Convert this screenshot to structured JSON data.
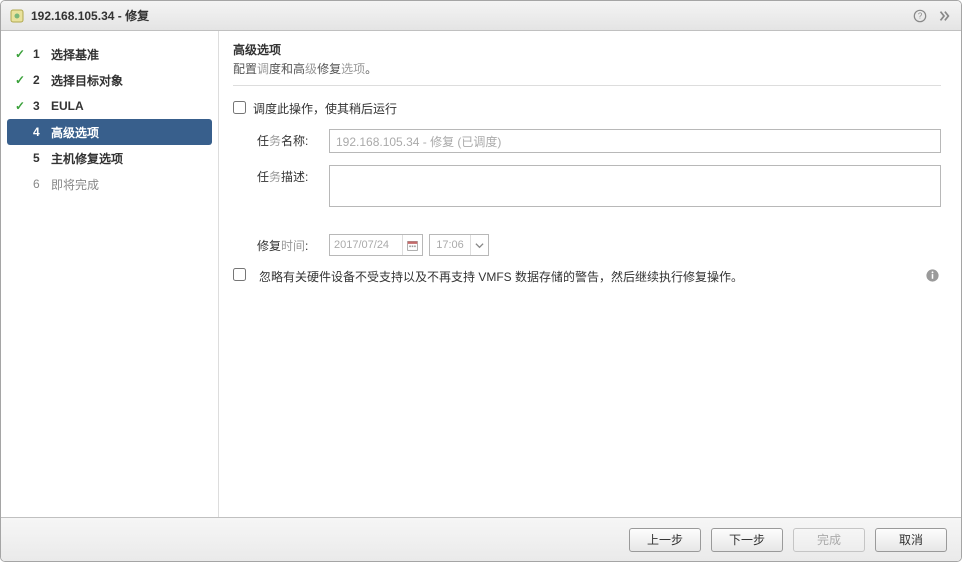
{
  "window": {
    "title": "192.168.105.34 - 修复"
  },
  "steps": [
    {
      "num": "1",
      "label": "选择基准",
      "done": true,
      "current": false
    },
    {
      "num": "2",
      "label": "选择目标对象",
      "done": true,
      "current": false
    },
    {
      "num": "3",
      "label": "EULA",
      "done": true,
      "current": false
    },
    {
      "num": "4",
      "label": "高级选项",
      "done": false,
      "current": true
    },
    {
      "num": "5",
      "label": "主机修复选项",
      "done": false,
      "current": false
    },
    {
      "num": "6",
      "label": "即将完成",
      "done": false,
      "current": false
    }
  ],
  "main": {
    "heading": "高级选项",
    "desc_parts": {
      "p1": "配置",
      "p2_grey": "调",
      "p3": "度和高",
      "p4_grey": "级",
      "p5": "修复",
      "p6_grey": "选项",
      "p7": "。"
    },
    "schedule_checkbox_label": "调度此操作，使其稍后运行",
    "task_name_label": "任务名称:",
    "task_name_value": "192.168.105.34 - 修复 (已调度)",
    "task_desc_label": "任务描述:",
    "task_desc_value": "",
    "repair_time_label": "修复时间:",
    "repair_date": "2017/07/24",
    "repair_time": "17:06",
    "ignore_warning_label": "忽略有关硬件设备不受支持以及不再支持 VMFS 数据存储的警告，然后继续执行修复操作。"
  },
  "footer": {
    "back": "上一步",
    "next": "下一步",
    "finish": "完成",
    "cancel": "取消"
  }
}
